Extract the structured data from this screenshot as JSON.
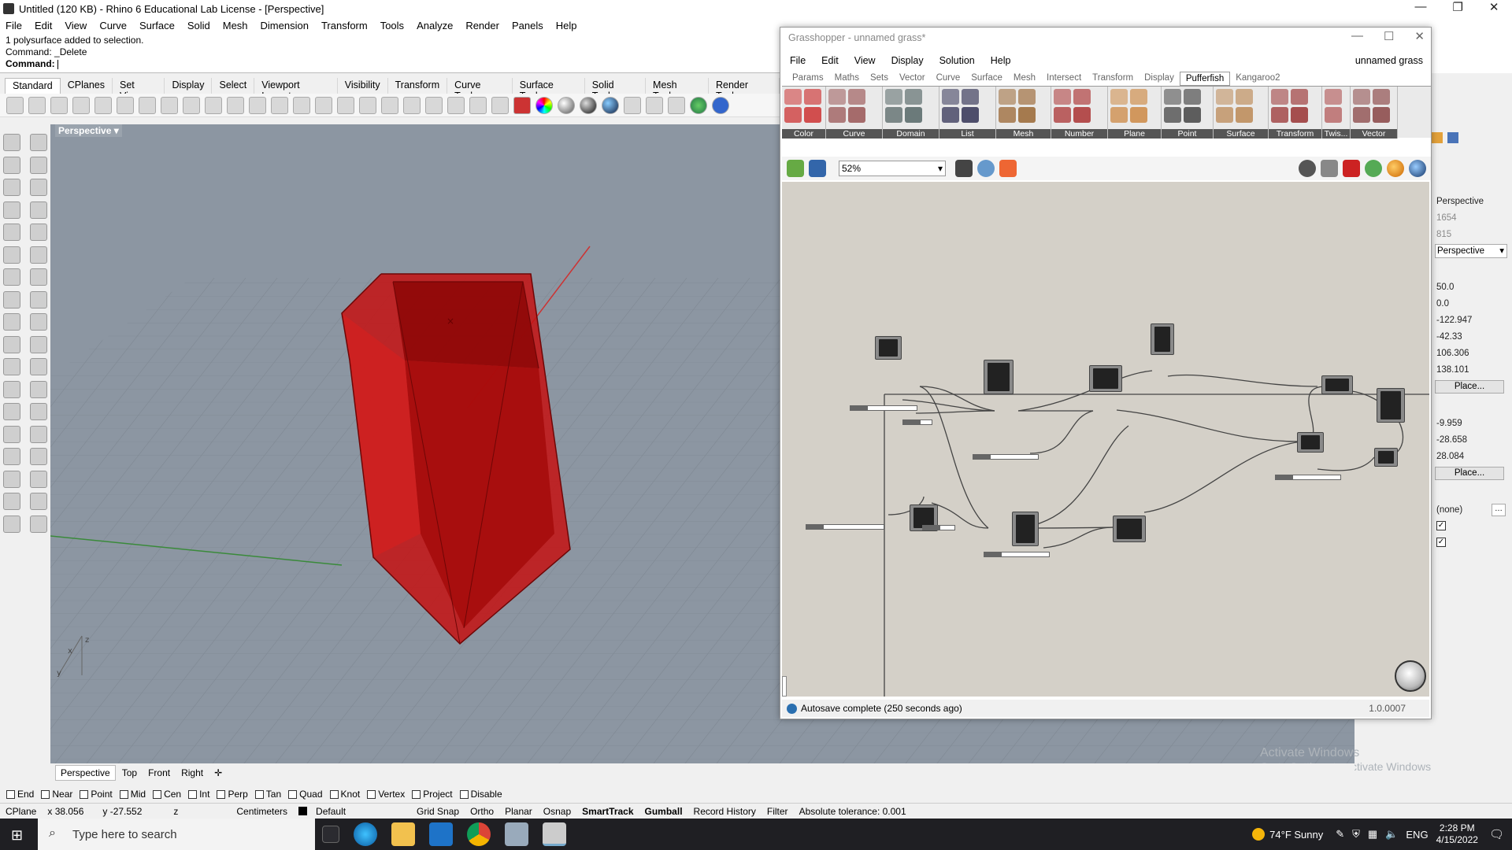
{
  "window": {
    "title": "Untitled (120 KB) - Rhino 6 Educational Lab License - [Perspective]"
  },
  "menu": [
    "File",
    "Edit",
    "View",
    "Curve",
    "Surface",
    "Solid",
    "Mesh",
    "Dimension",
    "Transform",
    "Tools",
    "Analyze",
    "Render",
    "Panels",
    "Help"
  ],
  "command": {
    "line1": "1 polysurface added to selection.",
    "line2": "Command: _Delete",
    "prompt": "Command:"
  },
  "toolbar_tabs": [
    "Standard",
    "CPlanes",
    "Set View",
    "Display",
    "Select",
    "Viewport Layout",
    "Visibility",
    "Transform",
    "Curve Tools",
    "Surface Tools",
    "Solid Tools",
    "Mesh Tools",
    "Render Tools"
  ],
  "viewport": {
    "label": "Perspective",
    "tabs": [
      "Perspective",
      "Top",
      "Front",
      "Right"
    ],
    "axis_x": "x",
    "axis_y": "y",
    "axis_z": "z"
  },
  "osnaps": [
    {
      "label": "End",
      "checked": false
    },
    {
      "label": "Near",
      "checked": false
    },
    {
      "label": "Point",
      "checked": false
    },
    {
      "label": "Mid",
      "checked": false
    },
    {
      "label": "Cen",
      "checked": false
    },
    {
      "label": "Int",
      "checked": false
    },
    {
      "label": "Perp",
      "checked": false
    },
    {
      "label": "Tan",
      "checked": false
    },
    {
      "label": "Quad",
      "checked": false
    },
    {
      "label": "Knot",
      "checked": false
    },
    {
      "label": "Vertex",
      "checked": false
    },
    {
      "label": "Project",
      "checked": false
    },
    {
      "label": "Disable",
      "checked": false
    }
  ],
  "status": {
    "cplane": "CPlane",
    "x": "x 38.056",
    "y": "y -27.552",
    "z": "z",
    "units": "Centimeters",
    "layer": "Default",
    "grid_snap": "Grid Snap",
    "ortho": "Ortho",
    "planar": "Planar",
    "osnap": "Osnap",
    "smarttrack": "SmartTrack",
    "gumball": "Gumball",
    "record": "Record History",
    "filter": "Filter",
    "tolerance": "Absolute tolerance: 0.001"
  },
  "right_panel": {
    "view": "Perspective",
    "width": "1654",
    "height": "815",
    "projection": "Perspective",
    "values1": [
      "50.0",
      "0.0",
      "-122.947",
      "-42.33",
      "106.306",
      "138.101"
    ],
    "place1": "Place...",
    "values2": [
      "-9.959",
      "-28.658",
      "28.084"
    ],
    "place2": "Place...",
    "none": "(none)"
  },
  "grasshopper": {
    "title": "Grasshopper - unnamed grass*",
    "menu": [
      "File",
      "Edit",
      "View",
      "Display",
      "Solution",
      "Help"
    ],
    "doc_name": "unnamed grass",
    "tabs": [
      "Params",
      "Maths",
      "Sets",
      "Vector",
      "Curve",
      "Surface",
      "Mesh",
      "Intersect",
      "Transform",
      "Display",
      "Pufferfish",
      "Kangaroo2"
    ],
    "active_tab": "Pufferfish",
    "groups": [
      "Color",
      "Curve",
      "Domain",
      "List",
      "Mesh",
      "Number",
      "Plane",
      "Point",
      "Surface",
      "Transform",
      "Twis...",
      "Vector"
    ],
    "zoom": "52%",
    "status": "Autosave complete (250 seconds ago)",
    "version": "1.0.0007"
  },
  "watermark": {
    "line1": "Activate Windows",
    "line2": "Go to Settings to activate Windows."
  },
  "taskbar": {
    "search": "Type here to search",
    "weather": "74°F  Sunny",
    "lang": "ENG",
    "time": "2:28 PM",
    "date": "4/15/2022"
  }
}
